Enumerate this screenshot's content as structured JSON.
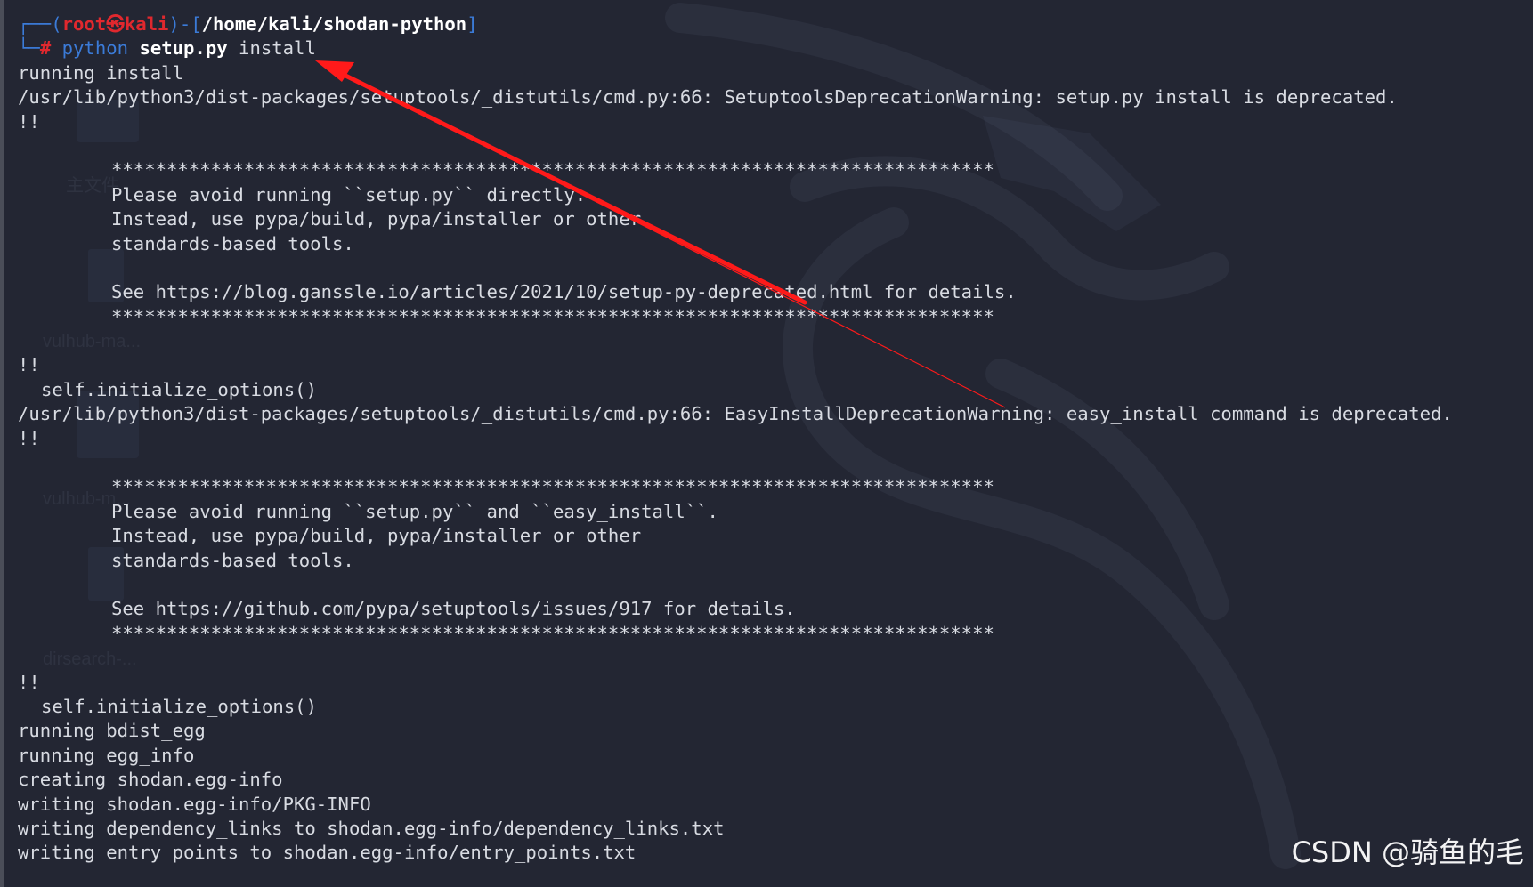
{
  "prompt": {
    "box_top": "┌──(",
    "box_bottom": "└─",
    "user": "root",
    "at_symbol": "㉿",
    "host": "kali",
    "mid": ")-[",
    "path": "/home/kali/shodan-python",
    "close": "]",
    "hash": "# ",
    "command": "python",
    "arg1": "setup.py",
    "arg2": "install"
  },
  "output": [
    {
      "text": "running install",
      "indent": 0
    },
    {
      "text": "/usr/lib/python3/dist-packages/setuptools/_distutils/cmd.py:66: SetuptoolsDeprecationWarning: setup.py install is deprecated.",
      "indent": 0
    },
    {
      "text": "!!",
      "indent": 0
    },
    {
      "text": "",
      "indent": 0
    },
    {
      "text": "********************************************************************************",
      "indent": 1
    },
    {
      "text": "Please avoid running ``setup.py`` directly.",
      "indent": 1
    },
    {
      "text": "Instead, use pypa/build, pypa/installer or other",
      "indent": 1
    },
    {
      "text": "standards-based tools.",
      "indent": 1
    },
    {
      "text": "",
      "indent": 0
    },
    {
      "text": "See https://blog.ganssle.io/articles/2021/10/setup-py-deprecated.html for details.",
      "indent": 1
    },
    {
      "text": "********************************************************************************",
      "indent": 1
    },
    {
      "text": "",
      "indent": 0
    },
    {
      "text": "!!",
      "indent": 0
    },
    {
      "text": "self.initialize_options()",
      "indent": 2
    },
    {
      "text": "/usr/lib/python3/dist-packages/setuptools/_distutils/cmd.py:66: EasyInstallDeprecationWarning: easy_install command is deprecated.",
      "indent": 0
    },
    {
      "text": "!!",
      "indent": 0
    },
    {
      "text": "",
      "indent": 0
    },
    {
      "text": "********************************************************************************",
      "indent": 1
    },
    {
      "text": "Please avoid running ``setup.py`` and ``easy_install``.",
      "indent": 1
    },
    {
      "text": "Instead, use pypa/build, pypa/installer or other",
      "indent": 1
    },
    {
      "text": "standards-based tools.",
      "indent": 1
    },
    {
      "text": "",
      "indent": 0
    },
    {
      "text": "See https://github.com/pypa/setuptools/issues/917 for details.",
      "indent": 1
    },
    {
      "text": "********************************************************************************",
      "indent": 1
    },
    {
      "text": "",
      "indent": 0
    },
    {
      "text": "!!",
      "indent": 0
    },
    {
      "text": "self.initialize_options()",
      "indent": 2
    },
    {
      "text": "running bdist_egg",
      "indent": 0
    },
    {
      "text": "running egg_info",
      "indent": 0
    },
    {
      "text": "creating shodan.egg-info",
      "indent": 0
    },
    {
      "text": "writing shodan.egg-info/PKG-INFO",
      "indent": 0
    },
    {
      "text": "writing dependency_links to shodan.egg-info/dependency_links.txt",
      "indent": 0
    },
    {
      "text": "writing entry points to shodan.egg-info/entry_points.txt",
      "indent": 0
    }
  ],
  "background_labels": [
    "主文件",
    "vulhub-ma...",
    "vulhub-m...",
    "dirsearch-..."
  ],
  "watermark": "CSDN @骑鱼的毛",
  "colors": {
    "background": "#232633",
    "text": "#d8dbe2",
    "prompt_blue": "#3b7bd8",
    "prompt_red": "#e0282e",
    "arrow": "#ff1a1a"
  }
}
